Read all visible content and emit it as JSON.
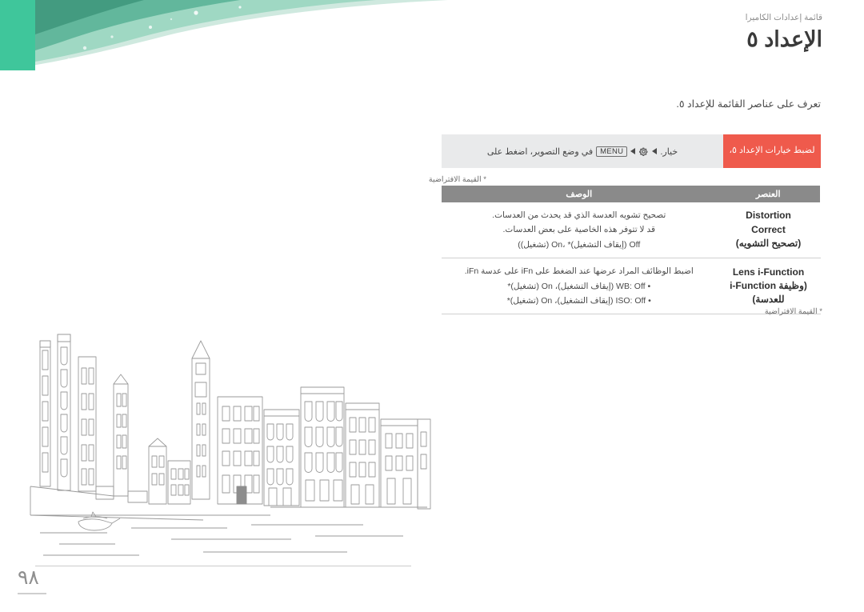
{
  "header": {
    "breadcrumb": "قائمة إعدادات الكاميرا",
    "title": "الإعداد ٥"
  },
  "page_number": "٩٨",
  "intro": "تعرف على عناصر القائمة للإعداد ٥.",
  "notice": {
    "badge": "لضبط خيارات الإعداد ٥،",
    "text_before": "في وضع التصوير، اضغط على",
    "key_menu": "MENU",
    "gear_icon": "gear-icon",
    "arrow_icon": "triangle-left-icon",
    "text_after": "خيار."
  },
  "footnote_top": "* القيمة الافتراضية",
  "footnote_bottom": "* القيمة الافتراضية",
  "table": {
    "headers": {
      "item": "العنصر",
      "description": "الوصف"
    },
    "rows": [
      {
        "name_lines": [
          "Distortion",
          "Correct",
          "(تصحيح التشويه)"
        ],
        "desc_lines": [
          "تصحيح تشويه العدسة الذي قد يحدث من العدسات.",
          "قد لا تتوفر هذه الخاصية على بعض العدسات.",
          "Off (إيقاف التشغيل)* ،On (تشغيل))"
        ]
      },
      {
        "name_lines": [
          "Lens i-Function",
          "(وظيفة i-Function",
          "للعدسة)"
        ],
        "desc_lines": [
          "اضبط الوظائف المراد عرضها عند الضغط على iFn على عدسة iFn.",
          "• WB: Off (إيقاف التشغيل)، On (تشغيل)*",
          "• ISO: Off (إيقاف التشغيل)، On (تشغيل)*"
        ]
      }
    ]
  },
  "colors": {
    "teal": "#3fc69b",
    "badge_red": "#ef5a4c",
    "header_grey": "#8a8a8a",
    "notice_bg": "#e9eaeb"
  },
  "illustration": {
    "name": "venice-canal-line-drawing"
  }
}
